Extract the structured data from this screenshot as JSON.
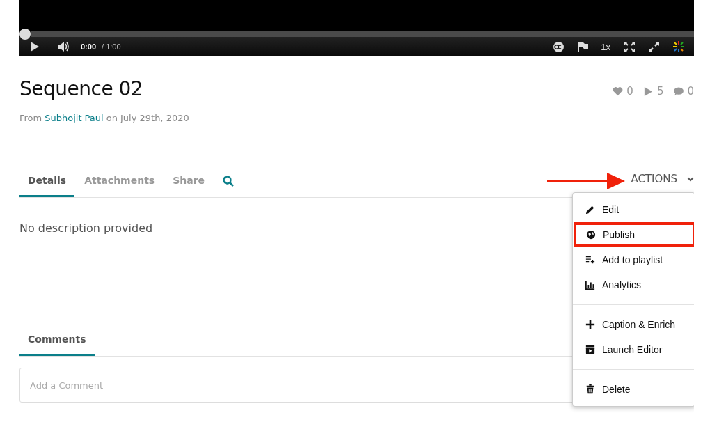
{
  "player": {
    "progress": {
      "level": 0
    },
    "time": "0:00",
    "duration": "/ 1:00",
    "speed": "1x"
  },
  "media": {
    "title": "Sequence 02",
    "byline": {
      "prefix": "From",
      "author": "Subhojit Paul",
      "suffix": "on July 29th, 2020"
    },
    "stats": [
      {
        "value": "0"
      },
      {
        "value": "5"
      },
      {
        "value": "0"
      }
    ]
  },
  "tabs": [
    {
      "label": "Details",
      "selected": true
    },
    {
      "label": "Attachments",
      "selected": false
    },
    {
      "label": "Share",
      "selected": false
    }
  ],
  "actions": {
    "label": "ACTIONS",
    "expanded": true
  },
  "description": "No description provided",
  "menu": {
    "groups": [
      [
        {
          "label": "Edit",
          "highlighted": false
        },
        {
          "label": "Publish",
          "highlighted": true
        },
        {
          "label": "Add to playlist",
          "highlighted": false
        },
        {
          "label": "Analytics",
          "highlighted": false
        }
      ],
      [
        {
          "label": "Caption & Enrich",
          "highlighted": false
        },
        {
          "label": "Launch Editor",
          "highlighted": false
        }
      ],
      [
        {
          "label": "Delete",
          "highlighted": false
        }
      ]
    ]
  },
  "comments": {
    "tabs": [
      {
        "label": "Comments",
        "selected": true
      }
    ],
    "input": {
      "placeholder": "Add a Comment"
    }
  }
}
